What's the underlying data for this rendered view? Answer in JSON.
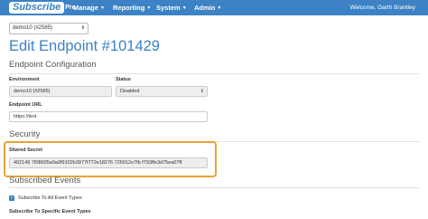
{
  "header": {
    "brand": "Subscribe",
    "brand_suffix": "Pro",
    "menus": [
      "Manage",
      "Reporting",
      "System",
      "Admin"
    ],
    "user": "Welcome, Garth Brantley"
  },
  "account_selector": {
    "value": "demo10 (#2585)"
  },
  "page_title": "Edit Endpoint #101429",
  "endpoint_configuration": {
    "heading": "Endpoint Configuration",
    "environment": {
      "label": "Environment",
      "value": "demo10 (#2585)"
    },
    "status": {
      "label": "Status",
      "value": "Disabled"
    },
    "endpoint_url": {
      "label": "Endpoint URL",
      "value": "https://test"
    }
  },
  "security": {
    "heading": "Security",
    "shared_secret": {
      "label": "Shared Secret",
      "value": "402149 7f08605a9a0f9102b3977f772e18276 726912e7fb f793ffe3d75ea07ff"
    }
  },
  "subscribed_events": {
    "heading": "Subscribed Events",
    "all_events": {
      "label": "Subscribe To All Event Types",
      "checked": true
    },
    "specific_label": "Subscribe To Specific Event Types"
  },
  "colors": {
    "accent": "#3c82c4",
    "highlight": "#e8a23b"
  }
}
